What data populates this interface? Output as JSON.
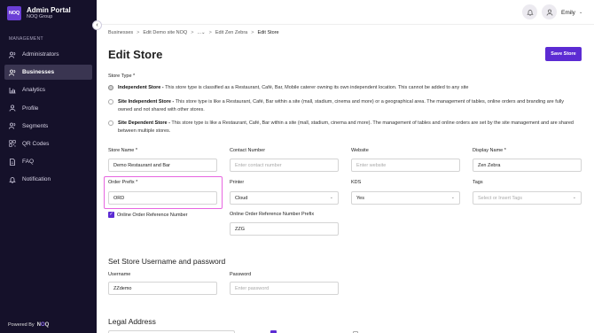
{
  "sidebar": {
    "logo_text": "NOQ",
    "app_title": "Admin Portal",
    "org_name": "NOQ Group",
    "collapse_icon": "‹",
    "menu_heading": "MANAGEMENT",
    "items": [
      {
        "label": "Administrators",
        "icon": "users-icon",
        "glyph": "⚇"
      },
      {
        "label": "Businesses",
        "icon": "store-icon",
        "glyph": "⚇"
      },
      {
        "label": "Analytics",
        "icon": "chart-icon",
        "glyph": "▥"
      },
      {
        "label": "Profile",
        "icon": "person-icon",
        "glyph": "○"
      },
      {
        "label": "Segments",
        "icon": "segments-icon",
        "glyph": "⚇"
      },
      {
        "label": "QR Codes",
        "icon": "qr-icon",
        "glyph": "▦"
      },
      {
        "label": "FAQ",
        "icon": "document-icon",
        "glyph": "▯"
      },
      {
        "label": "Notification",
        "icon": "bell-icon",
        "glyph": "♫"
      }
    ],
    "active_index": 1,
    "powered_by": "Powered By",
    "powered_logo_n": "N",
    "powered_logo_o": "O",
    "powered_logo_q": "Q"
  },
  "topbar": {
    "user_name": "Emily",
    "chevron": "⌄"
  },
  "breadcrumb": {
    "items": [
      "Businesses",
      "Edit Demo site NOQ",
      "...",
      "Edit Zen Zebra",
      "Edit Store"
    ],
    "sep": ">",
    "ellipsis_chevron": "⌄"
  },
  "page": {
    "title": "Edit Store",
    "save_label": "Save Store"
  },
  "store_type": {
    "label": "Store Type *",
    "options": [
      {
        "title": "Independent Store -",
        "desc": " This store type is classified as a Restaurant, Café, Bar, Mobile caterer owning its own independent location. This cannot be added to any site",
        "checked": true
      },
      {
        "title": "Site Independent Store -",
        "desc": " This store type is like a Restaurant, Café, Bar within a site (mall, stadium, cinema and more) or a geographical area. The management of tables, online orders and branding are fully owned and not shared with other stores.",
        "checked": false
      },
      {
        "title": "Site Dependent Store -",
        "desc": " This store type is like a Restaurant, Café, Bar within a site (mall, stadium, cinema and more). The management of tables and online orders are set by the site management and are shared between multiple stores.",
        "checked": false
      }
    ]
  },
  "form": {
    "store_name": {
      "label": "Store Name *",
      "value": "Demo Restaurant and Bar"
    },
    "contact_number": {
      "label": "Contact Number",
      "placeholder": "Enter contact number"
    },
    "website": {
      "label": "Website",
      "placeholder": "Enter website"
    },
    "display_name": {
      "label": "Display Name *",
      "value": "Zen Zebra"
    },
    "order_prefix": {
      "label": "Order Prefix *",
      "value": "ORD"
    },
    "printer": {
      "label": "Printer",
      "value": "Cloud"
    },
    "kds": {
      "label": "KDS",
      "value": "Yes"
    },
    "tags": {
      "label": "Tags",
      "placeholder": "Select or Insert Tags"
    },
    "online_ref_checkbox": {
      "label": "Online Order Reference Number",
      "checked": true,
      "check": "✓"
    },
    "online_ref_prefix": {
      "label": "Online Order Reference Number Prefix",
      "value": "ZZG"
    }
  },
  "credentials": {
    "title": "Set Store Username and password",
    "username": {
      "label": "Username",
      "value": "ZZdemo"
    },
    "password": {
      "label": "Password",
      "placeholder": "Enter password"
    }
  },
  "legal": {
    "title": "Legal Address"
  }
}
